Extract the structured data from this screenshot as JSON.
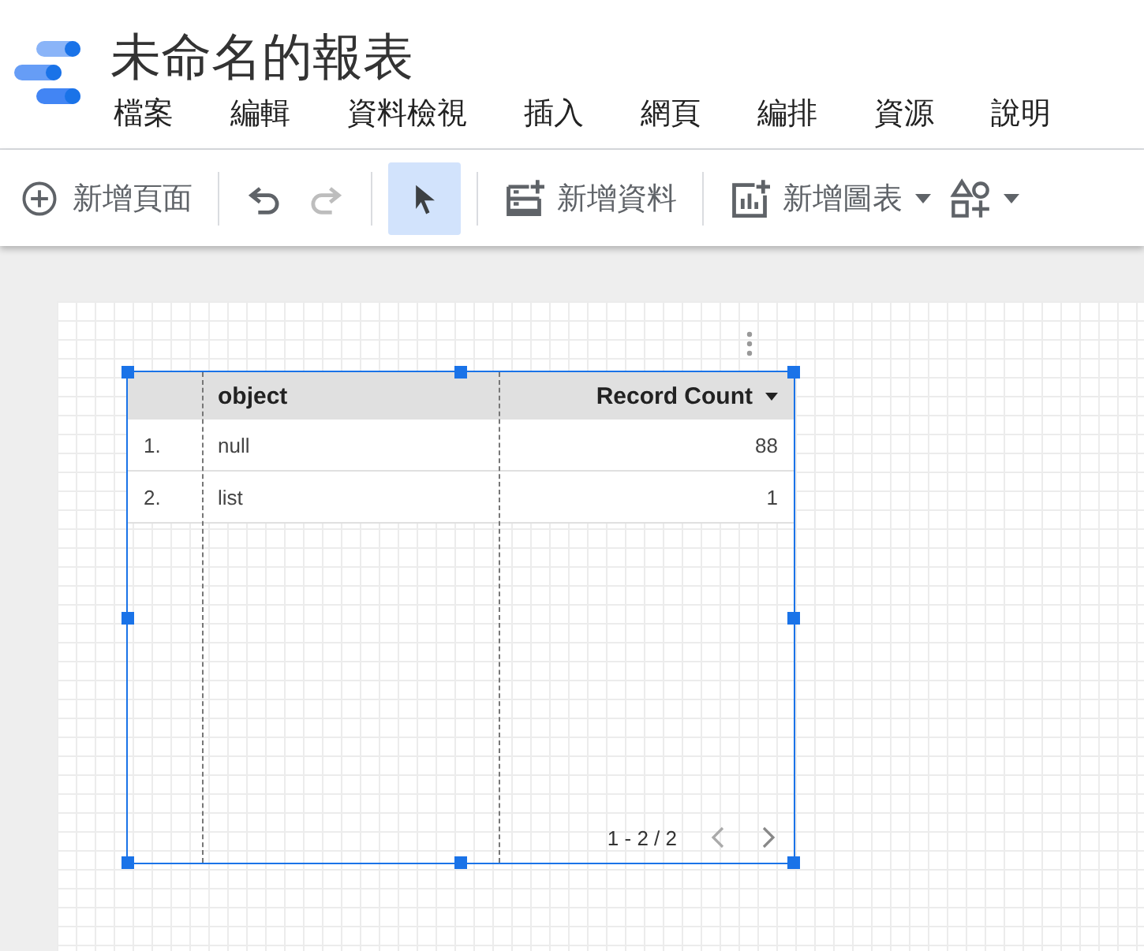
{
  "report": {
    "title": "未命名的報表"
  },
  "menu": [
    "檔案",
    "編輯",
    "資料檢視",
    "插入",
    "網頁",
    "編排",
    "資源",
    "說明"
  ],
  "toolbar": [
    {
      "kind": "add",
      "label": "新增頁面",
      "disabled": false,
      "selected": false
    },
    {
      "kind": "divider"
    },
    {
      "kind": "undo",
      "disabled": false,
      "selected": false
    },
    {
      "kind": "redo",
      "disabled": true,
      "selected": false
    },
    {
      "kind": "divider"
    },
    {
      "kind": "pointer",
      "disabled": false,
      "selected": true
    },
    {
      "kind": "divider"
    },
    {
      "kind": "data",
      "label": "新增資料",
      "disabled": false,
      "selected": false
    },
    {
      "kind": "divider"
    },
    {
      "kind": "chart",
      "label": "新增圖表",
      "disabled": false,
      "selected": false
    },
    {
      "kind": "shapes",
      "disabled": false,
      "selected": false
    }
  ],
  "table": {
    "columns": [
      {
        "label": "object",
        "kind": "dimension",
        "sorted": false
      },
      {
        "label": "Record Count",
        "kind": "metric",
        "sorted": true
      }
    ],
    "rows": [
      {
        "index": "1.",
        "cells": [
          "null",
          "88"
        ]
      },
      {
        "index": "2.",
        "cells": [
          "list",
          "1"
        ]
      }
    ],
    "pagination": "1 - 2 / 2"
  }
}
